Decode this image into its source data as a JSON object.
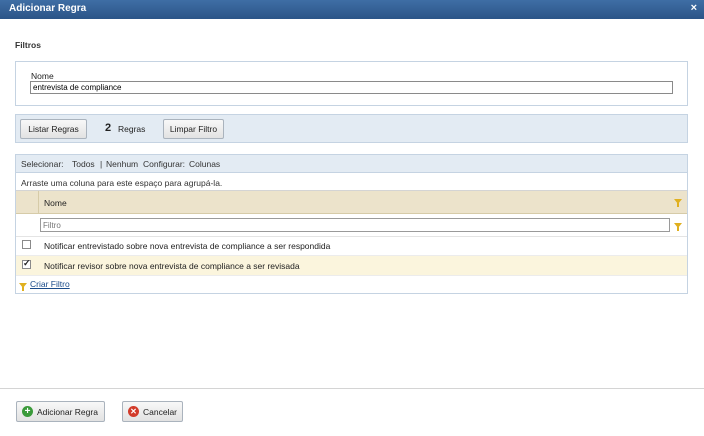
{
  "dialog": {
    "title": "Adicionar Regra",
    "close_symbol": "×"
  },
  "filtros": {
    "section_title": "Filtros",
    "nome_label": "Nome",
    "nome_value": "entrevista de compliance"
  },
  "toolbar": {
    "listar_label": "Listar Regras",
    "count": "2",
    "count_label": "Regras",
    "limpar_label": "Limpar Filtro"
  },
  "grid": {
    "selecionar_label": "Selecionar:",
    "todos": "Todos",
    "sep": "|",
    "nenhum": "Nenhum",
    "configurar_label": "Configurar:",
    "colunas": "Colunas",
    "group_hint": "Arraste uma coluna para este espaço para agrupá-la.",
    "column_name": "Nome",
    "filter_placeholder": "Filtro",
    "rows": [
      {
        "label": "Notificar entrevistado sobre nova entrevista de compliance a ser respondida",
        "checked": false
      },
      {
        "label": "Notificar revisor sobre nova entrevista de compliance a ser revisada",
        "checked": true
      }
    ],
    "criar_filtro": "Criar Filtro"
  },
  "footer": {
    "add_label": "Adicionar Regra",
    "cancel_label": "Cancelar"
  },
  "colors": {
    "title_bar": "#2f5c92",
    "panel_bg": "#e3ebf3",
    "header_bg": "#ece3cb",
    "selected_row": "#fbf5dd"
  }
}
